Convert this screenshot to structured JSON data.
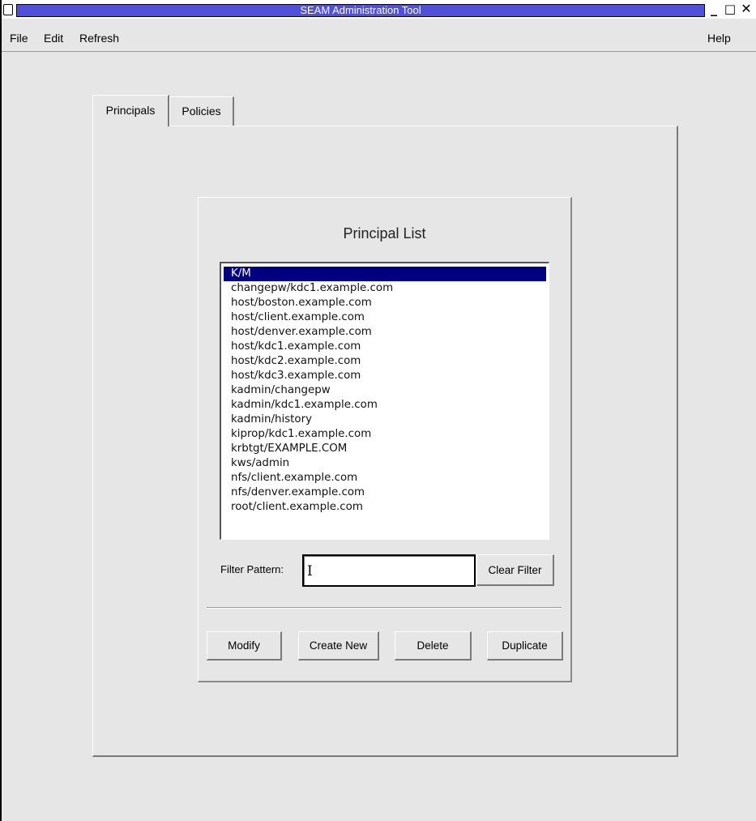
{
  "window": {
    "title": "SEAM Administration Tool"
  },
  "window_controls": {
    "minimize": "_",
    "maximize": "□",
    "close": "✕"
  },
  "menu": {
    "file": "File",
    "edit": "Edit",
    "refresh": "Refresh",
    "help": "Help"
  },
  "tabs": [
    {
      "label": "Principals",
      "selected": true
    },
    {
      "label": "Policies",
      "selected": false
    }
  ],
  "principals_panel": {
    "title": "Principal List",
    "selected_item": "K/M",
    "items": [
      "K/M",
      "changepw/kdc1.example.com",
      "host/boston.example.com",
      "host/client.example.com",
      "host/denver.example.com",
      "host/kdc1.example.com",
      "host/kdc2.example.com",
      "host/kdc3.example.com",
      "kadmin/changepw",
      "kadmin/kdc1.example.com",
      "kadmin/history",
      "kiprop/kdc1.example.com",
      "krbtgt/EXAMPLE.COM",
      "kws/admin",
      "nfs/client.example.com",
      "nfs/denver.example.com",
      "root/client.example.com"
    ],
    "filter": {
      "label": "Filter Pattern:",
      "value": "",
      "clear_label": "Clear Filter"
    },
    "buttons": {
      "modify": "Modify",
      "create_new": "Create New",
      "delete": "Delete",
      "duplicate": "Duplicate"
    }
  },
  "colors": {
    "title_bar": "#5050d8",
    "selection": "#000080",
    "background": "#e6e6e6"
  }
}
